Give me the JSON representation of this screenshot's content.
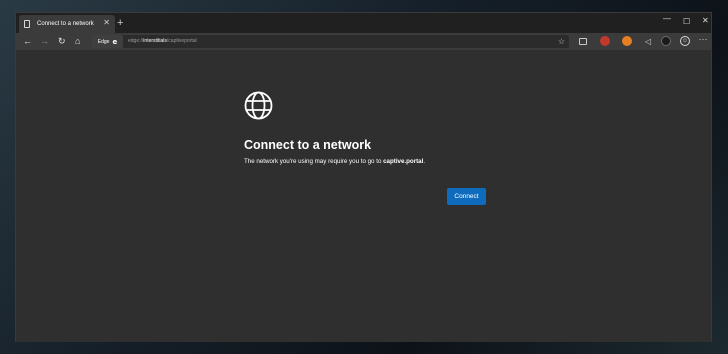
{
  "tab": {
    "title": "Connect to a network",
    "close_glyph": "✕",
    "new_tab_glyph": "+"
  },
  "window_controls": {
    "minimize": "—",
    "maximize": "☐",
    "close": "✕"
  },
  "toolbar": {
    "back": "←",
    "forward": "→",
    "refresh": "↻",
    "home": "⌂",
    "identity_chip": "Edge",
    "url_scheme": "edge://",
    "url_path": "interstitials",
    "url_rest": "/captiveportal",
    "favorite_glyph": "☆"
  },
  "extensions": {
    "e4_glyph": "◁",
    "e6_glyph": "☺",
    "menu_glyph": "···"
  },
  "page": {
    "heading": "Connect to a network",
    "description_prefix": "The network you're using may require you to go to ",
    "description_domain": "captive.portal",
    "description_suffix": ".",
    "connect_label": "Connect"
  },
  "colors": {
    "accent": "#0f6cbd",
    "page_background": "#2f2f2f",
    "toolbar": "#3b3b3b"
  }
}
